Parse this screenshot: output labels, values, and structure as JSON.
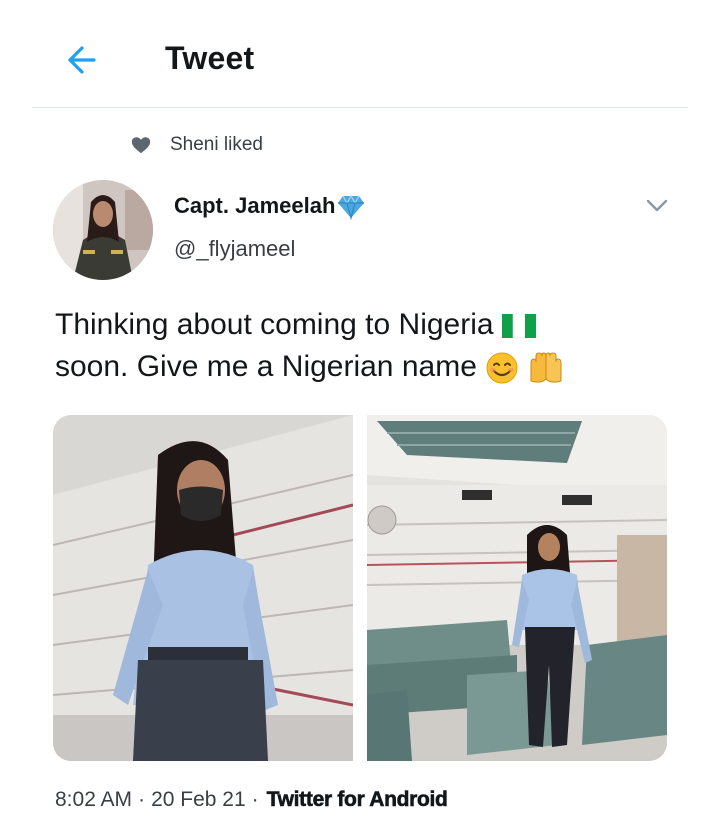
{
  "header": {
    "title": "Tweet",
    "back_icon": "arrow-left-icon",
    "accent": "#1da1f2"
  },
  "social_context": {
    "icon": "heart-icon",
    "text": "Sheni liked"
  },
  "author": {
    "display_name": "Capt. Jameelah",
    "badge_icon": "diamond-emoji",
    "handle": "@_flyjameel"
  },
  "tweet": {
    "text_line1": "Thinking about coming to Nigeria",
    "text_line2": "soon. Give me a Nigerian name",
    "emojis": [
      "nigeria-flag-emoji",
      "smiling-face-emoji",
      "raising-hands-emoji"
    ],
    "media": [
      {
        "name": "photo-woman-masked-hallway"
      },
      {
        "name": "photo-woman-lounge-chairs"
      }
    ]
  },
  "meta": {
    "time": "8:02 AM",
    "separator": "·",
    "date": "20 Feb 21",
    "source": "Twitter for Android"
  }
}
